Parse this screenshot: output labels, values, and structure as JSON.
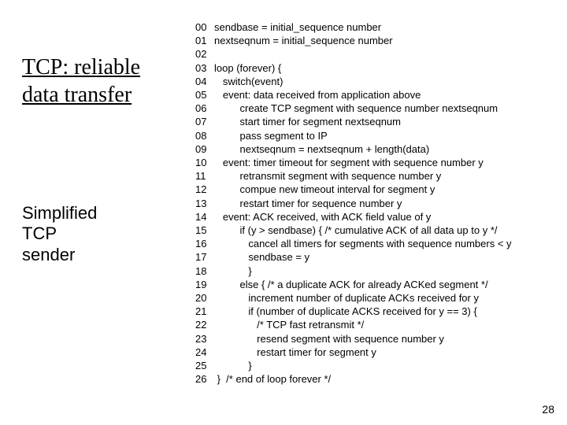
{
  "left": {
    "title_line1": "TCP: reliable",
    "title_line2": "data transfer",
    "subtitle_line1": "Simplified",
    "subtitle_line2": "TCP",
    "subtitle_line3": "sender"
  },
  "code": [
    {
      "n": "00",
      "t": "sendbase = initial_sequence number"
    },
    {
      "n": "01",
      "t": "nextseqnum = initial_sequence number"
    },
    {
      "n": "02",
      "t": ""
    },
    {
      "n": "03",
      "t": "loop (forever) {"
    },
    {
      "n": "04",
      "t": "   switch(event)"
    },
    {
      "n": "05",
      "t": "   event: data received from application above"
    },
    {
      "n": "06",
      "t": "         create TCP segment with sequence number nextseqnum"
    },
    {
      "n": "07",
      "t": "         start timer for segment nextseqnum"
    },
    {
      "n": "08",
      "t": "         pass segment to IP"
    },
    {
      "n": "09",
      "t": "         nextseqnum = nextseqnum + length(data)"
    },
    {
      "n": "10",
      "t": "   event: timer timeout for segment with sequence number y"
    },
    {
      "n": "11",
      "t": "         retransmit segment with sequence number y"
    },
    {
      "n": "12",
      "t": "         compue new timeout interval for segment y"
    },
    {
      "n": "13",
      "t": "         restart timer for sequence number y"
    },
    {
      "n": "14",
      "t": "   event: ACK received, with ACK field value of y"
    },
    {
      "n": "15",
      "t": "         if (y > sendbase) { /* cumulative ACK of all data up to y */"
    },
    {
      "n": "16",
      "t": "            cancel all timers for segments with sequence numbers < y"
    },
    {
      "n": "17",
      "t": "            sendbase = y"
    },
    {
      "n": "18",
      "t": "            }"
    },
    {
      "n": "19",
      "t": "         else { /* a duplicate ACK for already ACKed segment */"
    },
    {
      "n": "20",
      "t": "            increment number of duplicate ACKs received for y"
    },
    {
      "n": "21",
      "t": "            if (number of duplicate ACKS received for y == 3) {"
    },
    {
      "n": "22",
      "t": "               /* TCP fast retransmit */"
    },
    {
      "n": "23",
      "t": "               resend segment with sequence number y"
    },
    {
      "n": "24",
      "t": "               restart timer for segment y"
    },
    {
      "n": "25",
      "t": "            }"
    },
    {
      "n": "26",
      "t": " }  /* end of loop forever */"
    }
  ],
  "page_number": "28"
}
